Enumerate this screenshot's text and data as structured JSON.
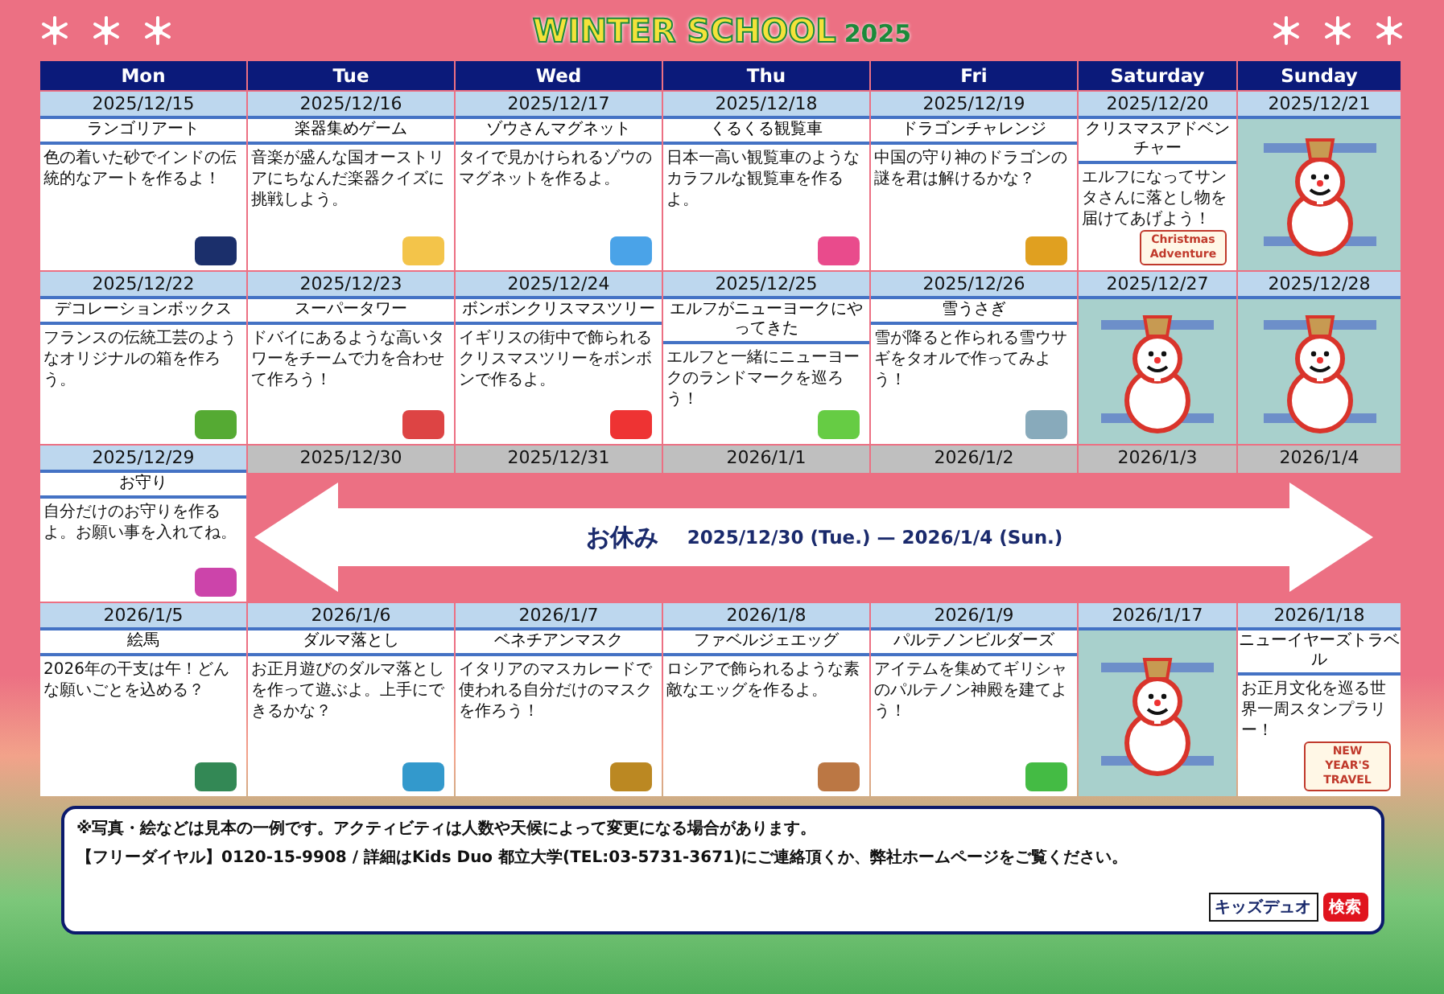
{
  "header": {
    "title": "WINTER SCHOOL",
    "year": "2025"
  },
  "weekdays": [
    "Mon",
    "Tue",
    "Wed",
    "Thu",
    "Fri",
    "Saturday",
    "Sunday"
  ],
  "weeks": [
    {
      "days": [
        {
          "date": "2025/12/15",
          "kind": "activity",
          "title": "ランゴリアート",
          "description": "色の着いた砂でインドの伝統的なアートを作るよ！"
        },
        {
          "date": "2025/12/16",
          "kind": "activity",
          "title": "楽器集めゲーム",
          "description": "音楽が盛んな国オーストリアにちなんだ楽器クイズに挑戦しよう。"
        },
        {
          "date": "2025/12/17",
          "kind": "activity",
          "title": "ゾウさんマグネット",
          "description": "タイで見かけられるゾウのマグネットを作るよ。"
        },
        {
          "date": "2025/12/18",
          "kind": "activity",
          "title": "くるくる観覧車",
          "description": "日本一高い観覧車のようなカラフルな観覧車を作るよ。"
        },
        {
          "date": "2025/12/19",
          "kind": "activity",
          "title": "ドラゴンチャレンジ",
          "description": "中国の守り神のドラゴンの謎を君は解けるかな？"
        },
        {
          "date": "2025/12/20",
          "kind": "activity",
          "title": "クリスマスアドベンチャー",
          "description": "エルフになってサンタさんに落とし物を届けてあげよう！",
          "picture_label": "Christmas Adventure"
        },
        {
          "date": "2025/12/21",
          "kind": "snowman"
        }
      ]
    },
    {
      "days": [
        {
          "date": "2025/12/22",
          "kind": "activity",
          "title": "デコレーションボックス",
          "description": "フランスの伝統工芸のようなオリジナルの箱を作ろう。"
        },
        {
          "date": "2025/12/23",
          "kind": "activity",
          "title": "スーパータワー",
          "description": "ドバイにあるような高いタワーをチームで力を合わせて作ろう！"
        },
        {
          "date": "2025/12/24",
          "kind": "activity",
          "title": "ボンボンクリスマスツリー",
          "description": "イギリスの街中で飾られるクリスマスツリーをボンボンで作るよ。"
        },
        {
          "date": "2025/12/25",
          "kind": "activity",
          "title": "エルフがニューヨークにやってきた",
          "description": "エルフと一緒にニューヨークのランドマークを巡ろう！"
        },
        {
          "date": "2025/12/26",
          "kind": "activity",
          "title": "雪うさぎ",
          "description": "雪が降ると作られる雪ウサギをタオルで作ってみよう！"
        },
        {
          "date": "2025/12/27",
          "kind": "snowman"
        },
        {
          "date": "2025/12/28",
          "kind": "snowman"
        }
      ]
    },
    {
      "days": [
        {
          "date": "2025/12/29",
          "kind": "activity",
          "title": "お守り",
          "description": "自分だけのお守りを作るよ。お願い事を入れてね。"
        },
        {
          "date": "2025/12/30",
          "kind": "holiday"
        },
        {
          "date": "2025/12/31",
          "kind": "holiday"
        },
        {
          "date": "2026/1/1",
          "kind": "holiday"
        },
        {
          "date": "2026/1/2",
          "kind": "holiday"
        },
        {
          "date": "2026/1/3",
          "kind": "holiday"
        },
        {
          "date": "2026/1/4",
          "kind": "holiday"
        }
      ],
      "holiday_banner": {
        "label": "お休み",
        "period": "2025/12/30 (Tue.) — 2026/1/4 (Sun.)"
      }
    },
    {
      "days": [
        {
          "date": "2026/1/5",
          "kind": "activity",
          "title": "絵馬",
          "description": "2026年の干支は午！どんな願いごとを込める？"
        },
        {
          "date": "2026/1/6",
          "kind": "activity",
          "title": "ダルマ落とし",
          "description": "お正月遊びのダルマ落としを作って遊ぶよ。上手にできるかな？"
        },
        {
          "date": "2026/1/7",
          "kind": "activity",
          "title": "ベネチアンマスク",
          "description": "イタリアのマスカレードで使われる自分だけのマスクを作ろう！"
        },
        {
          "date": "2026/1/8",
          "kind": "activity",
          "title": "ファベルジェエッグ",
          "description": "ロシアで飾られるような素敵なエッグを作るよ。"
        },
        {
          "date": "2026/1/9",
          "kind": "activity",
          "title": "パルテノンビルダーズ",
          "description": "アイテムを集めてギリシャのパルテノン神殿を建てよう！"
        },
        {
          "date": "2026/1/17",
          "kind": "snowman"
        },
        {
          "date": "2026/1/18",
          "kind": "activity",
          "title": "ニューイヤーズトラベル",
          "description": "お正月文化を巡る世界一周スタンプラリー！",
          "picture_label": "NEW YEAR'S TRAVEL"
        }
      ]
    }
  ],
  "footer": {
    "notes": [
      "※写真・絵などは見本の一例です。アクティビティは人数や天候によって変更になる場合があります。",
      "【フリーダイヤル】0120-15-9908 / 詳細はKids Duo 都立大学(TEL:03-5731-3671)にご連絡頂くか、弊社ホームページをご覧ください。"
    ],
    "search_keyword": "キッズデュオ",
    "search_button": "検索"
  }
}
